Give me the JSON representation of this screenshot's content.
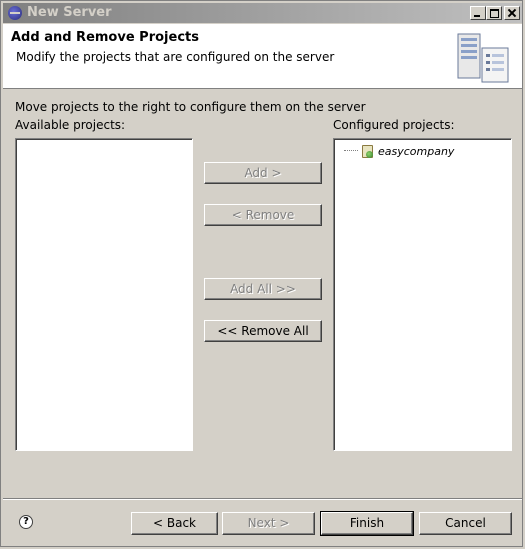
{
  "window": {
    "title": "New Server"
  },
  "header": {
    "title": "Add and Remove Projects",
    "description": "Modify the projects that are configured on the server",
    "graphic_icon": "server-icon"
  },
  "main": {
    "instruction": "Move projects to the right to configure them on the server",
    "available_label": "Available projects:",
    "configured_label": "Configured projects:",
    "available_items": [],
    "configured_items": [
      {
        "label": "easycompany",
        "icon": "web-project-icon"
      }
    ]
  },
  "buttons": {
    "add": "Add >",
    "remove": "< Remove",
    "add_all": "Add All >>",
    "remove_all": "<< Remove All"
  },
  "footer": {
    "help": "?",
    "back": "< Back",
    "next": "Next >",
    "finish": "Finish",
    "cancel": "Cancel"
  }
}
